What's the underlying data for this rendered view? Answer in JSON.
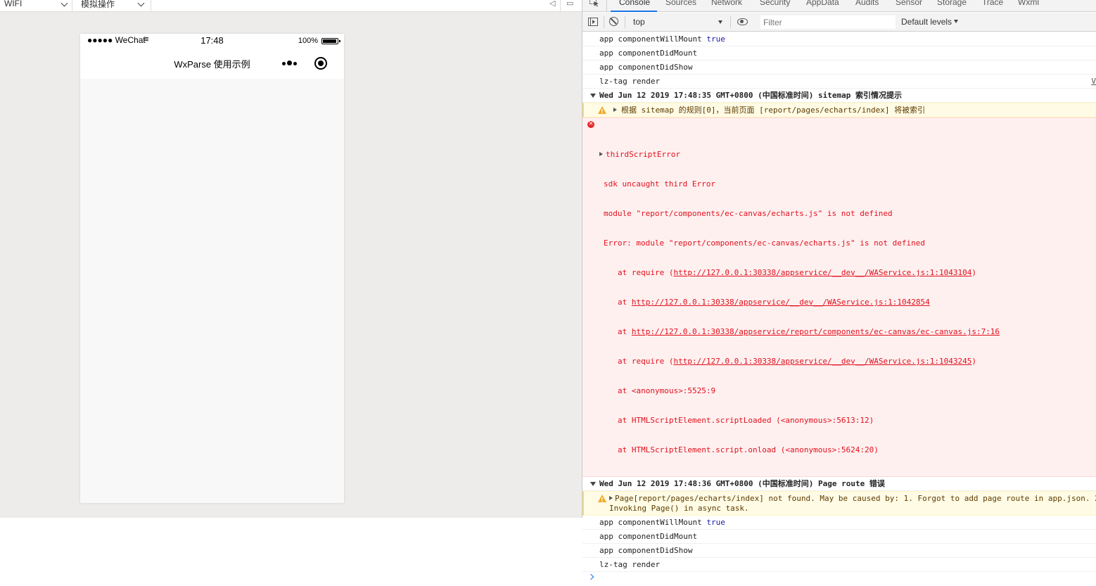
{
  "simulator": {
    "toolbar": {
      "network_select": "WIFI",
      "operation_select": "模拟操作"
    },
    "phone": {
      "carrier": "●●●●● WeChat",
      "time": "17:48",
      "battery": "100%",
      "nav_title": "WxParse 使用示例"
    }
  },
  "devtools": {
    "tabs": [
      "Console",
      "Sources",
      "Network",
      "Security",
      "AppData",
      "Audits",
      "Sensor",
      "Storage",
      "Trace",
      "Wxml"
    ],
    "active_tab": "Console",
    "toolbar": {
      "context": "top",
      "filter_placeholder": "Filter",
      "levels": "Default levels"
    },
    "console": {
      "msg1": {
        "text": "app componentWillMount ",
        "kw": "true"
      },
      "msg2": "app componentDidMount",
      "msg3": "app componentDidShow",
      "msg4": {
        "text": "lz-tag render",
        "source": "V"
      },
      "group1_header": "Wed Jun 12 2019 17:48:35 GMT+0800 (中国标准时间) sitemap 索引情况提示",
      "warn1": "根据 sitemap 的规则[0]，当前页面 [report/pages/echarts/index] 将被索引",
      "error": {
        "title": "thirdScriptError",
        "line1": "sdk uncaught third Error",
        "line2": "module \"report/components/ec-canvas/echarts.js\" is not defined",
        "line3": "Error: module \"report/components/ec-canvas/echarts.js\" is not defined",
        "stack": [
          {
            "prefix": "at require (",
            "link": "http://127.0.0.1:30338/appservice/__dev__/WAService.js:1:1043104",
            "suffix": ")"
          },
          {
            "prefix": "at ",
            "link": "http://127.0.0.1:30338/appservice/__dev__/WAService.js:1:1042854",
            "suffix": ""
          },
          {
            "prefix": "at ",
            "link": "http://127.0.0.1:30338/appservice/report/components/ec-canvas/ec-canvas.js:7:16",
            "suffix": ""
          },
          {
            "prefix": "at require (",
            "link": "http://127.0.0.1:30338/appservice/__dev__/WAService.js:1:1043245",
            "suffix": ")"
          },
          {
            "prefix": "at <anonymous>:5525:9",
            "link": "",
            "suffix": ""
          },
          {
            "prefix": "at HTMLScriptElement.scriptLoaded (<anonymous>:5613:12)",
            "link": "",
            "suffix": ""
          },
          {
            "prefix": "at HTMLScriptElement.script.onload (<anonymous>:5624:20)",
            "link": "",
            "suffix": ""
          }
        ]
      },
      "group2_header": "Wed Jun 12 2019 17:48:36 GMT+0800 (中国标准时间) Page route 错误",
      "warn2_line1": "Page[report/pages/echarts/index] not found. May be caused by: 1. Forgot to add page route in app.json. 2",
      "warn2_line2": "Invoking Page() in async task.",
      "msg5": {
        "text": "app componentWillMount ",
        "kw": "true"
      },
      "msg6": "app componentDidMount",
      "msg7": "app componentDidShow",
      "msg8": "lz-tag render"
    }
  }
}
